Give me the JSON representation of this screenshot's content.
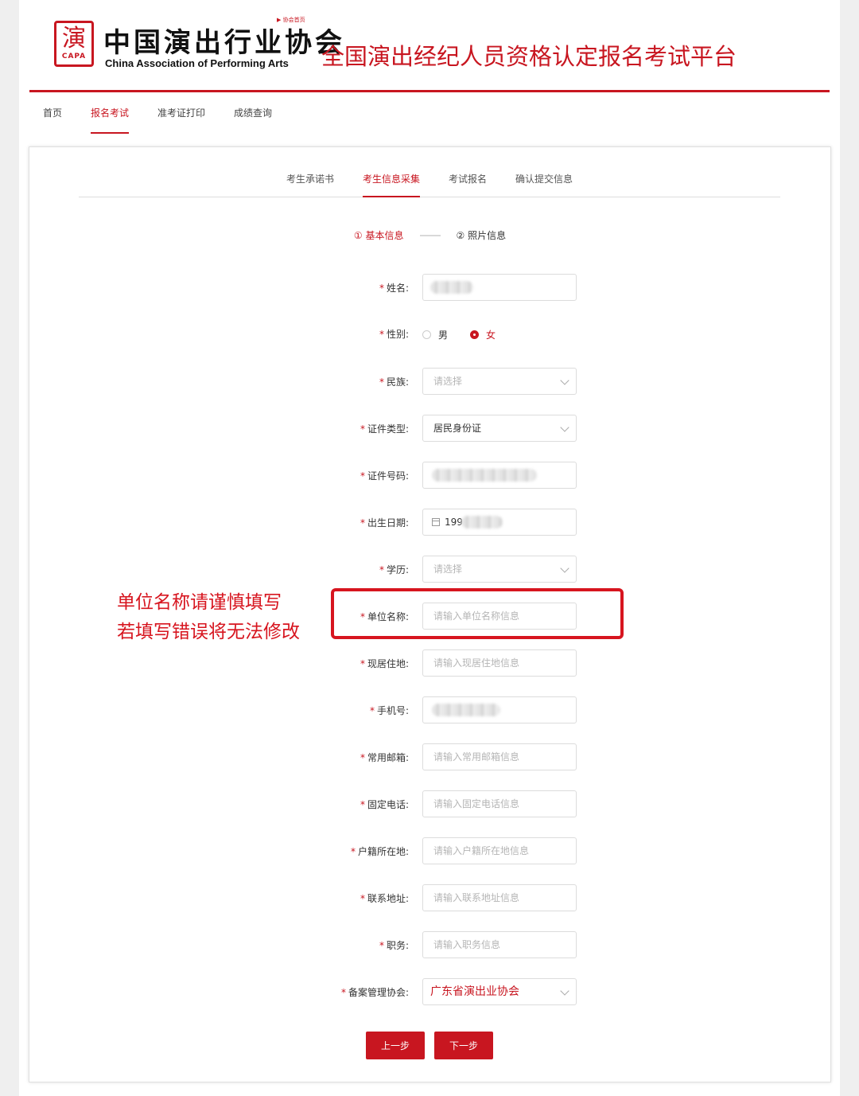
{
  "header": {
    "seal_glyph": "演",
    "seal_abbr": "CAPA",
    "association_cn": "中国演出行业协会",
    "association_en": "China Association of Performing Arts",
    "home_link": "▶ 协会首页",
    "platform_title": "全国演出经纪人员资格认定报名考试平台"
  },
  "topnav": [
    "首页",
    "报名考试",
    "准考证打印",
    "成绩查询"
  ],
  "topnav_active": 1,
  "steps": [
    "考生承诺书",
    "考生信息采集",
    "考试报名",
    "确认提交信息"
  ],
  "steps_active": 1,
  "substeps": {
    "active": "① 基本信息",
    "next": "② 照片信息"
  },
  "form": {
    "name": {
      "label": "姓名:"
    },
    "gender": {
      "label": "性别:",
      "options": [
        "男",
        "女"
      ],
      "selected": "女"
    },
    "ethnicity": {
      "label": "民族:",
      "placeholder": "请选择"
    },
    "id_type": {
      "label": "证件类型:",
      "value": "居民身份证"
    },
    "id_number": {
      "label": "证件号码:"
    },
    "birth_date": {
      "label": "出生日期:",
      "value": "199"
    },
    "education": {
      "label": "学历:",
      "placeholder": "请选择"
    },
    "employer": {
      "label": "单位名称:",
      "placeholder": "请输入单位名称信息"
    },
    "current_address": {
      "label": "现居住地:",
      "placeholder": "请输入现居住地信息"
    },
    "mobile": {
      "label": "手机号:"
    },
    "email": {
      "label": "常用邮箱:",
      "placeholder": "请输入常用邮箱信息"
    },
    "landline": {
      "label": "固定电话:",
      "placeholder": "请输入固定电话信息"
    },
    "household": {
      "label": "户籍所在地:",
      "placeholder": "请输入户籍所在地信息"
    },
    "contact_address": {
      "label": "联系地址:",
      "placeholder": "请输入联系地址信息"
    },
    "position": {
      "label": "职务:",
      "placeholder": "请输入职务信息"
    },
    "registry_assoc": {
      "label": "备案管理协会:",
      "value": "广东省演出业协会"
    }
  },
  "annotation": {
    "line1": "单位名称请谨慎填写",
    "line2": "若填写错误将无法修改"
  },
  "buttons": {
    "prev": "上一步",
    "next": "下一步"
  },
  "colors": {
    "brand_red": "#c81620",
    "annotation_red": "#d7151f"
  }
}
